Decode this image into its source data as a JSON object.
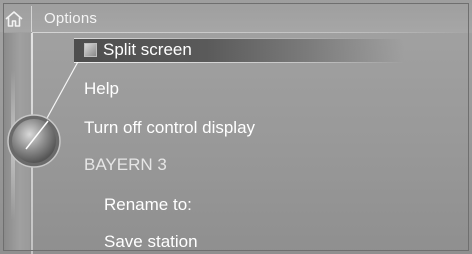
{
  "header": {
    "title": "Options"
  },
  "menu": {
    "items": [
      {
        "label": "Split screen",
        "selected": true
      },
      {
        "label": "Help",
        "selected": false
      },
      {
        "label": "Turn off control display",
        "selected": false
      },
      {
        "label": "BAYERN 3",
        "selected": false
      },
      {
        "label": "Rename to:",
        "selected": false
      },
      {
        "label": "Save station",
        "selected": false
      }
    ]
  },
  "icons": {
    "home": "home-icon",
    "controller": "controller-knob-icon",
    "selection": "selection-marker-icon"
  }
}
